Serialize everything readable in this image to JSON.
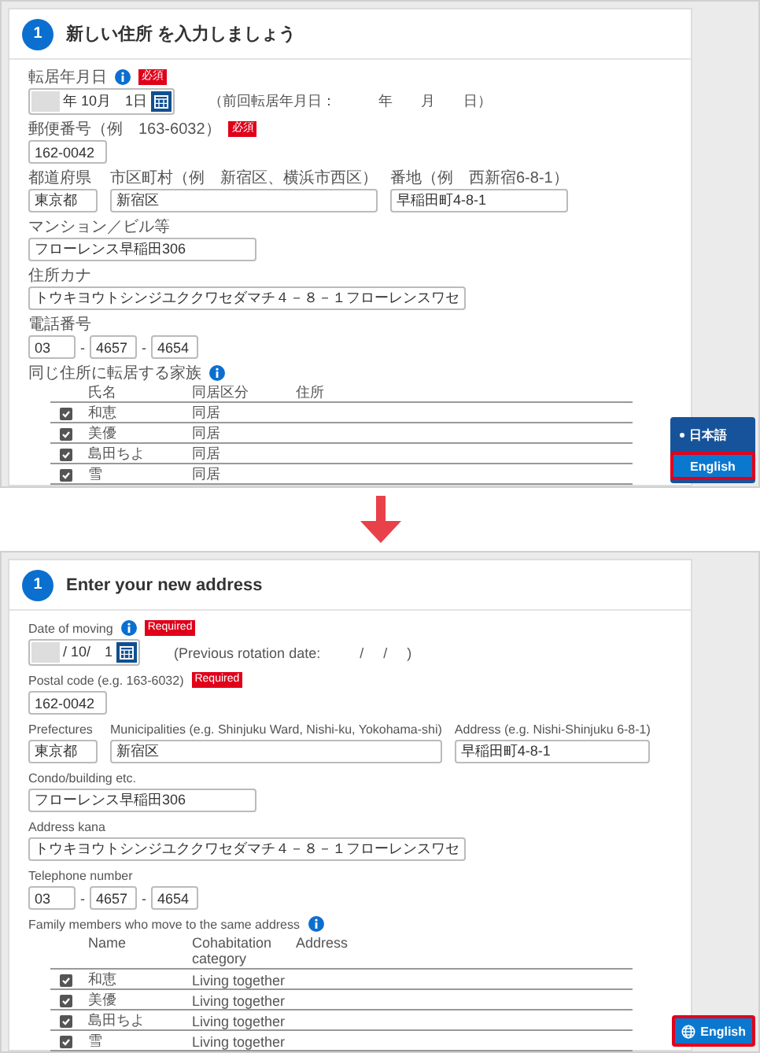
{
  "panels": [
    {
      "step": "1",
      "title": "新しい住所 を入力しましょう",
      "date": {
        "label": "転居年月日",
        "required": "必須",
        "value": "年 10月　1日",
        "previous": "（前回転居年月日：　　　年　　月　　日）"
      },
      "postal": {
        "label": "郵便番号（例　163-6032）",
        "required": "必須",
        "value": "162-0042"
      },
      "address_fields": [
        {
          "label": "都道府県",
          "value": "東京都"
        },
        {
          "label": "市区町村（例　新宿区、横浜市西区）",
          "value": "新宿区"
        },
        {
          "label": "番地（例　西新宿6-8-1）",
          "value": "早稲田町4-8-1"
        }
      ],
      "building": {
        "label": "マンション／ビル等",
        "value": "フローレンス早稲田306"
      },
      "kana": {
        "label": "住所カナ",
        "value": "トウキヨウトシンジユククワセダマチ４－８－１フローレンスワセ"
      },
      "phone": {
        "label": "電話番号",
        "parts": [
          "03",
          "4657",
          "4654"
        ],
        "separator": "-"
      },
      "family": {
        "label": "同じ住所に転居する家族",
        "columns": [
          "氏名",
          "同居区分",
          "住所"
        ],
        "rows": [
          {
            "checked": true,
            "name": "和恵",
            "category": "同居"
          },
          {
            "checked": true,
            "name": "美優",
            "category": "同居"
          },
          {
            "checked": true,
            "name": "島田ちよ",
            "category": "同居"
          },
          {
            "checked": true,
            "name": "雪",
            "category": "同居"
          }
        ]
      },
      "language": {
        "kind": "menu",
        "items": [
          {
            "label": "日本語",
            "selected": true,
            "highlighted": false
          },
          {
            "label": "English",
            "selected": false,
            "highlighted": true
          }
        ]
      }
    },
    {
      "step": "1",
      "title": "Enter your new address",
      "date": {
        "label": "Date of moving",
        "required": "Required",
        "value": "/ 10/　1",
        "previous": "(Previous rotation date:          /     /     )"
      },
      "postal": {
        "label": "Postal code (e.g. 163-6032)",
        "required": "Required",
        "value": "162-0042"
      },
      "address_fields": [
        {
          "label": "Prefectures",
          "value": "東京都"
        },
        {
          "label": "Municipalities (e.g. Shinjuku Ward, Nishi-ku, Yokohama-shi)",
          "value": "新宿区"
        },
        {
          "label": "Address (e.g. Nishi-Shinjuku 6-8-1)",
          "value": "早稲田町4-8-1"
        }
      ],
      "building": {
        "label": "Condo/building etc.",
        "value": "フローレンス早稲田306"
      },
      "kana": {
        "label": "Address kana",
        "value": "トウキヨウトシンジユククワセダマチ４－８－１フローレンスワセ"
      },
      "phone": {
        "label": "Telephone number",
        "parts": [
          "03",
          "4657",
          "4654"
        ],
        "separator": "-"
      },
      "family": {
        "label": "Family members who move to the same address",
        "columns": [
          "Name",
          "Cohabitation category",
          "Address"
        ],
        "rows": [
          {
            "checked": true,
            "name": "和恵",
            "category": "Living together"
          },
          {
            "checked": true,
            "name": "美優",
            "category": "Living together"
          },
          {
            "checked": true,
            "name": "島田ちよ",
            "category": "Living together"
          },
          {
            "checked": true,
            "name": "雪",
            "category": "Living together"
          }
        ]
      },
      "language": {
        "kind": "button",
        "items": [
          {
            "label": "English",
            "selected": true,
            "highlighted": true
          }
        ]
      }
    }
  ]
}
